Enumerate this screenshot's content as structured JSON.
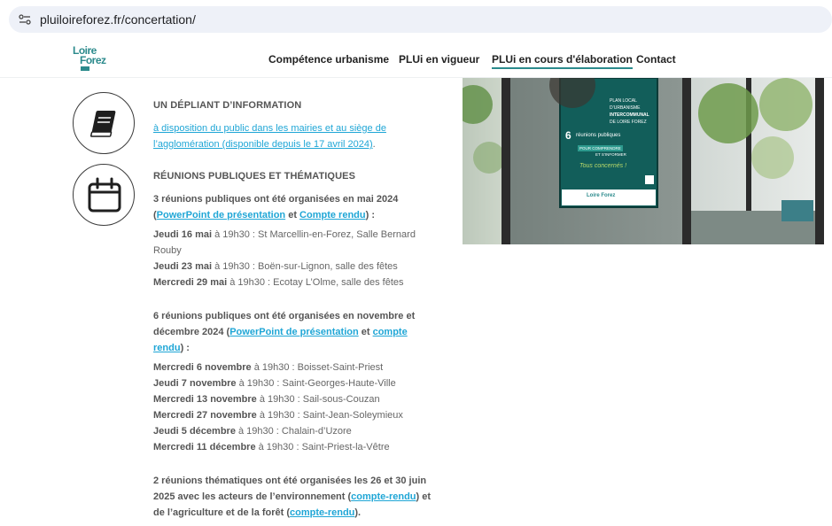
{
  "browser": {
    "url": "pluiloireforez.fr/concertation/"
  },
  "nav": {
    "logo_line1": "Loire",
    "logo_line2": "Forez",
    "items": [
      {
        "label": "Compétence urbanisme"
      },
      {
        "label": "PLUi en vigueur"
      },
      {
        "label": "PLUi en cours d'élaboration",
        "active": true
      },
      {
        "label": "Contact"
      }
    ]
  },
  "content": {
    "truncated_top": "",
    "depliant": {
      "heading": "UN DÉPLIANT D’INFORMATION",
      "link_line1": "à disposition du public dans les mairies et au siège de",
      "link_line2": "l’agglomération (disponible depuis le 17 avril 2024)",
      "tail": "."
    },
    "reunions": {
      "heading": "RÉUNIONS PUBLIQUES ET THÉMATIQUES",
      "mai": {
        "intro_line1": "3 réunions publiques ont été organisées en mai 2024",
        "open": "(",
        "link1": "PowerPoint de présentation",
        "and": " et ",
        "link2": "Compte rendu",
        "close": ") :",
        "items": [
          {
            "date": "Jeudi 16 mai",
            "rest": " à 19h30 : St Marcellin-en-Forez, Salle Bernard"
          },
          {
            "date": "",
            "rest": "Rouby"
          },
          {
            "date": "Jeudi 23 mai",
            "rest": " à 19h30 : Boën-sur-Lignon, salle des fêtes"
          },
          {
            "date": "Mercredi 29 mai",
            "rest": " à 19h30 : Ecotay L’Olme, salle des fêtes"
          }
        ]
      },
      "novdec": {
        "intro_line1": "6 réunions publiques ont été organisées en novembre et",
        "intro_line2_pre": "décembre 2024 (",
        "link1": "PowerPoint de présentation",
        "and": " et ",
        "link2a": "compte",
        "link2b": "rendu",
        "close": ") :",
        "items": [
          {
            "date": "Mercredi 6 novembre",
            "rest": " à 19h30 : Boisset-Saint-Priest"
          },
          {
            "date": "Jeudi 7 novembre",
            "rest": " à 19h30 : Saint-Georges-Haute-Ville"
          },
          {
            "date": "Mercredi 13 novembre",
            "rest": " à 19h30 : Sail-sous-Couzan"
          },
          {
            "date": "Mercredi 27 novembre",
            "rest": " à 19h30 : Saint-Jean-Soleymieux"
          },
          {
            "date": "Jeudi 5 décembre",
            "rest": " à 19h30 : Chalain-d’Uzore"
          },
          {
            "date": "Mercredi 11 décembre",
            "rest": " à 19h30 : Saint-Priest-la-Vêtre"
          }
        ]
      },
      "thema": {
        "line1": "2 réunions thématiques ont été organisées les 26 et 30 juin",
        "line2_pre": "2025 avec les acteurs de l’environnement (",
        "line2_link": "compte-rendu",
        "line2_post": ") et",
        "line3_pre": "de l’agriculture et de la forêt (",
        "line3_link": "compte-rendu",
        "line3_post": ")."
      }
    }
  },
  "poster": {
    "line1": "PLAN LOCAL",
    "line2": "D’URBANISME",
    "line3": "INTERCOMMUNAL",
    "line4": "DE LOIRE FOREZ",
    "number": "6",
    "reunions": "réunions publiques",
    "pour": "POUR COMPRENDRE",
    "et": "ET S’INFORMER",
    "tous": "Tous concernés !",
    "logo": "Loire Forez"
  },
  "colors": {
    "accent": "#2b8a8c",
    "link": "#1fa6d6"
  }
}
